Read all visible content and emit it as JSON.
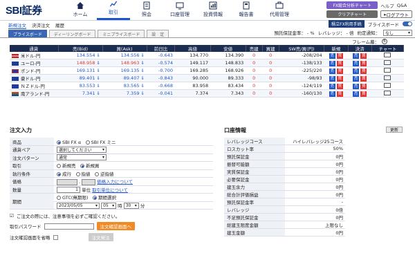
{
  "brand": {
    "logo": "SBI証券"
  },
  "nav": [
    {
      "label": "ホーム",
      "icon": "home-icon"
    },
    {
      "label": "取引",
      "icon": "trade-chart-icon"
    },
    {
      "label": "照会",
      "icon": "document-icon"
    },
    {
      "label": "口座管理",
      "icon": "account-icon"
    },
    {
      "label": "投資情報",
      "icon": "info-icon"
    },
    {
      "label": "報告書",
      "icon": "report-icon"
    },
    {
      "label": "代用管理",
      "icon": "collateral-icon"
    }
  ],
  "header": {
    "fx_chart_btn": "FX総合分析チャート",
    "clear_chart_btn": "クリアチャート",
    "help": "ヘルプ",
    "qa": "Q&A",
    "logout": "ログアウト"
  },
  "subnav": [
    "新規注文",
    "決済注文",
    "履歴"
  ],
  "tabs": [
    "プライスボード",
    "ディーリングボード",
    "ミニプライスボード",
    "設　定"
  ],
  "boardright": {
    "fx_btn": "積立FX利用手続",
    "margin_label": "預託保証金率： -  %",
    "leverage_label": "レバレッジ： - 倍",
    "notify_label": "約定通知：",
    "notify_value": "なし",
    "priceboard_label": "プライスボード"
  },
  "frame": {
    "label": "フレーム幕：",
    "value": "6"
  },
  "rate_table": {
    "headers": [
      "通貨",
      "売(Bid)",
      "買(Ask)",
      "前日比",
      "高値",
      "安値",
      "売建",
      "買建",
      "SW売/買(円)",
      "新規",
      "決済",
      "チャート"
    ],
    "rows": [
      {
        "pair": "米ドル-円",
        "bid": "134.554",
        "ask": "134.556",
        "change": "-0.643",
        "high": "134.770",
        "low": "134.390",
        "short": "0",
        "long": "0",
        "sw": "-208/204"
      },
      {
        "pair": "ユーロ-円",
        "bid": "148.958",
        "ask": "148.963",
        "change": "-0.574",
        "high": "149.117",
        "low": "148.833",
        "short": "0",
        "long": "0",
        "sw": "-138/133"
      },
      {
        "pair": "ポンド-円",
        "bid": "169.131",
        "ask": "169.135",
        "change": "-0.700",
        "high": "169.285",
        "low": "168.926",
        "short": "0",
        "long": "0",
        "sw": "-225/220"
      },
      {
        "pair": "豪ドル-円",
        "bid": "89.401",
        "ask": "89.407",
        "change": "-0.843",
        "high": "90.000",
        "low": "89.333",
        "short": "0",
        "long": "0",
        "sw": "-98/93"
      },
      {
        "pair": "ＮＺドル-円",
        "bid": "83.553",
        "ask": "83.565",
        "change": "-0.668",
        "high": "83.958",
        "low": "83.434",
        "short": "0",
        "long": "0",
        "sw": "-124/119"
      },
      {
        "pair": "南アランド-円",
        "bid": "7.341",
        "ask": "7.359",
        "change": "-0.041",
        "high": "7.374",
        "low": "7.343",
        "short": "0",
        "long": "0",
        "sw": "-160/130"
      }
    ],
    "new_buy": "売",
    "new_sell": "買",
    "settle_sell": "売",
    "settle_buy": "買"
  },
  "order": {
    "title": "注文入力",
    "product_label": "商品",
    "product_opt1": "SBI FX α",
    "product_opt2": "SBI FX ミニ",
    "pair_label": "通貨ペア",
    "pair_value": "選択してください",
    "pattern_label": "注文パターン",
    "pattern_value": "通常",
    "trade_label": "取引",
    "trade_opt1": "新規売",
    "trade_opt2": "新規買",
    "exec_label": "執行条件",
    "exec_opt1": "成行",
    "exec_opt2": "指値",
    "exec_opt3": "逆指値",
    "price_label": "価格",
    "price_link": "価格入力について",
    "qty_label": "数量",
    "qty_value": "1",
    "qty_unit": "単位",
    "qty_link": "取引単位について",
    "period_label": "期間",
    "period_opt1": "GTC(無期限)",
    "period_opt2": "期間選択",
    "date_value": "2023/05/05",
    "hour_value": "05",
    "hour_unit": "時",
    "min_value": "30",
    "min_unit": "分",
    "notice": "ご注文の際には、注意事項を必ずご確認ください。",
    "password_label": "取引パスワード",
    "confirm_btn": "注文確認画面へ",
    "skip_label": "注文確認画面を省略",
    "submit_btn": "注文発注"
  },
  "account": {
    "title": "口座情報",
    "refresh": "更新",
    "rows": [
      {
        "label": "レバレッジコース",
        "value": "ハイレバレッジ25コース"
      },
      {
        "label": "ロスカット率",
        "value": "50%"
      },
      {
        "label": "預託保証金",
        "value": "0円"
      },
      {
        "label": "振替可能額",
        "value": "0円"
      },
      {
        "label": "実質保証金",
        "value": "0円"
      },
      {
        "label": "必要保証金",
        "value": "0円"
      },
      {
        "label": "建玉余力",
        "value": "0円"
      },
      {
        "label": "総合計評価損益",
        "value": "0円"
      },
      {
        "label": "預託保証金率",
        "value": "-"
      },
      {
        "label": "レバレッジ",
        "value": "0倍"
      },
      {
        "label": "不足預託保証金",
        "value": "0円"
      },
      {
        "label": "総建玉限度金額",
        "value": "上限なし"
      },
      {
        "label": "建玉金額",
        "value": "0円"
      }
    ]
  },
  "colors": {
    "brand": "#0b2a66",
    "accent": "#1e56c8",
    "table_header": "#1c2d52",
    "sell": "#d33333",
    "order_btn": "#f08a24"
  }
}
